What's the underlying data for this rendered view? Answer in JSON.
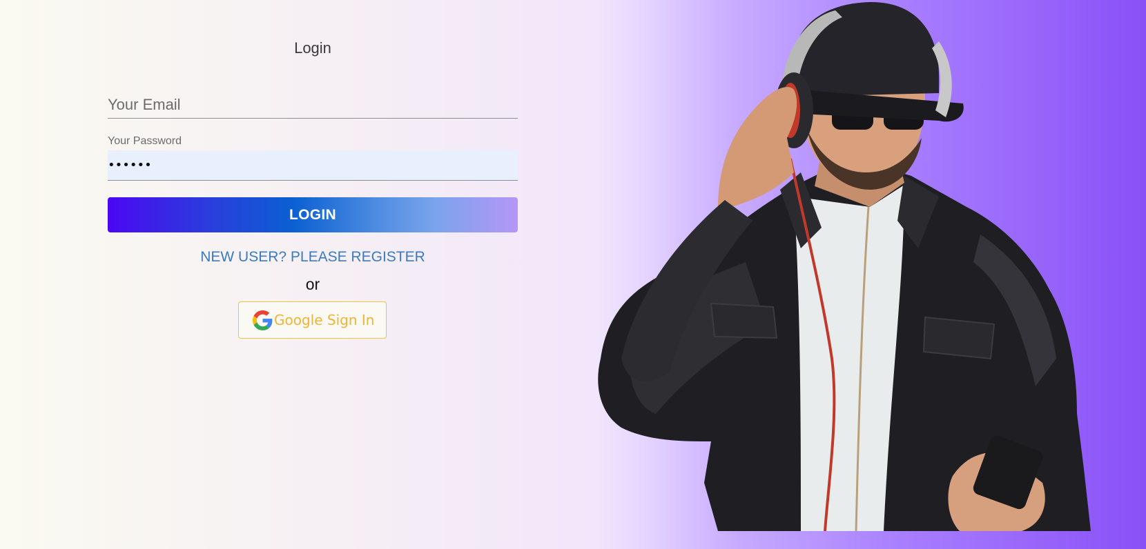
{
  "login": {
    "title": "Login",
    "email_placeholder": "Your Email",
    "password_label": "Your Password",
    "password_value": "••••••",
    "login_button_label": "LOGIN",
    "register_link_label": "NEW USER? PLEASE REGISTER",
    "or_text": "or",
    "google_button_label": "Google Sign In"
  },
  "colors": {
    "button_gradient_start": "#4a08f2",
    "button_gradient_end": "#b596f6",
    "link": "#3a7abf",
    "google_text": "#f0b436",
    "background_right": "#8a50f7"
  },
  "icons": {
    "google": "google-g-icon"
  },
  "hero": {
    "subject": "man-with-headphones-image"
  }
}
